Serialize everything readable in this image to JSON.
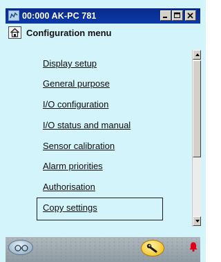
{
  "window": {
    "title": "00:000 AK-PC 781",
    "controls": [
      "minimize",
      "maximize",
      "close"
    ]
  },
  "header": {
    "title": "Configuration menu",
    "home_icon": "home-icon"
  },
  "menu": {
    "items": [
      {
        "label": "Display setup"
      },
      {
        "label": "General purpose"
      },
      {
        "label": "I/O configuration"
      },
      {
        "label": "I/O status and manual"
      },
      {
        "label": "Sensor calibration"
      },
      {
        "label": "Alarm priorities"
      },
      {
        "label": "Authorisation"
      },
      {
        "label": "Copy settings",
        "selected": true
      }
    ]
  },
  "statusbar": {
    "left_icon": "glasses-icon",
    "tool_icon": "wrench-icon",
    "alarm_icon": "bell-icon"
  },
  "colors": {
    "title_bar": "#0b3aa8",
    "background": "#d4f4fb",
    "alarm": "#e0001a",
    "tool": "#f0b800"
  }
}
